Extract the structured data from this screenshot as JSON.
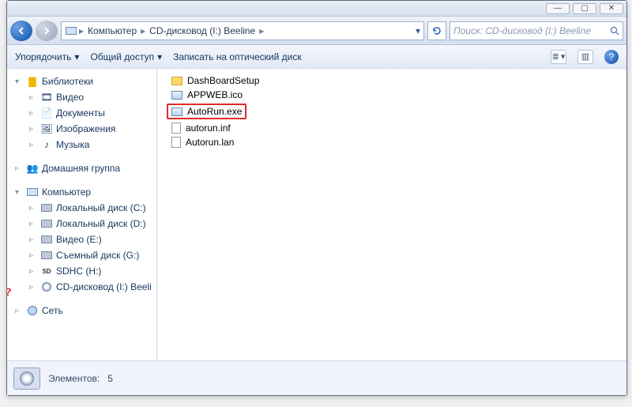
{
  "window": {
    "min": "—",
    "max": "▢",
    "close": "✕"
  },
  "breadcrumb": {
    "root": "Компьютер",
    "current": "CD-дисковод (I:) Beeline"
  },
  "search": {
    "placeholder": "Поиск: CD-дисковод (I:) Beeline"
  },
  "toolbar": {
    "organize": "Упорядочить",
    "share": "Общий доступ",
    "burn": "Записать на оптический диск"
  },
  "nav": {
    "libraries": "Библиотеки",
    "video": "Видео",
    "documents": "Документы",
    "pictures": "Изображения",
    "music": "Музыка",
    "homegroup": "Домашняя группа",
    "computer": "Компьютер",
    "localC": "Локальный диск (C:)",
    "localD": "Локальный диск (D:)",
    "videoE": "Видео (E:)",
    "removG": "Съемный диск (G:)",
    "sdhc": "SDHC (H:)",
    "cdI": "CD-дисковод (I:) Beeli",
    "network": "Сеть"
  },
  "files": [
    {
      "icon": "fold",
      "name": "DashBoardSetup"
    },
    {
      "icon": "exe",
      "name": "APPWEB.ico"
    },
    {
      "icon": "exe",
      "name": "AutoRun.exe",
      "highlight": true
    },
    {
      "icon": "gen",
      "name": "autorun.inf"
    },
    {
      "icon": "gen",
      "name": "Autorun.lan"
    }
  ],
  "status": {
    "label": "Элементов:",
    "count": "5"
  }
}
